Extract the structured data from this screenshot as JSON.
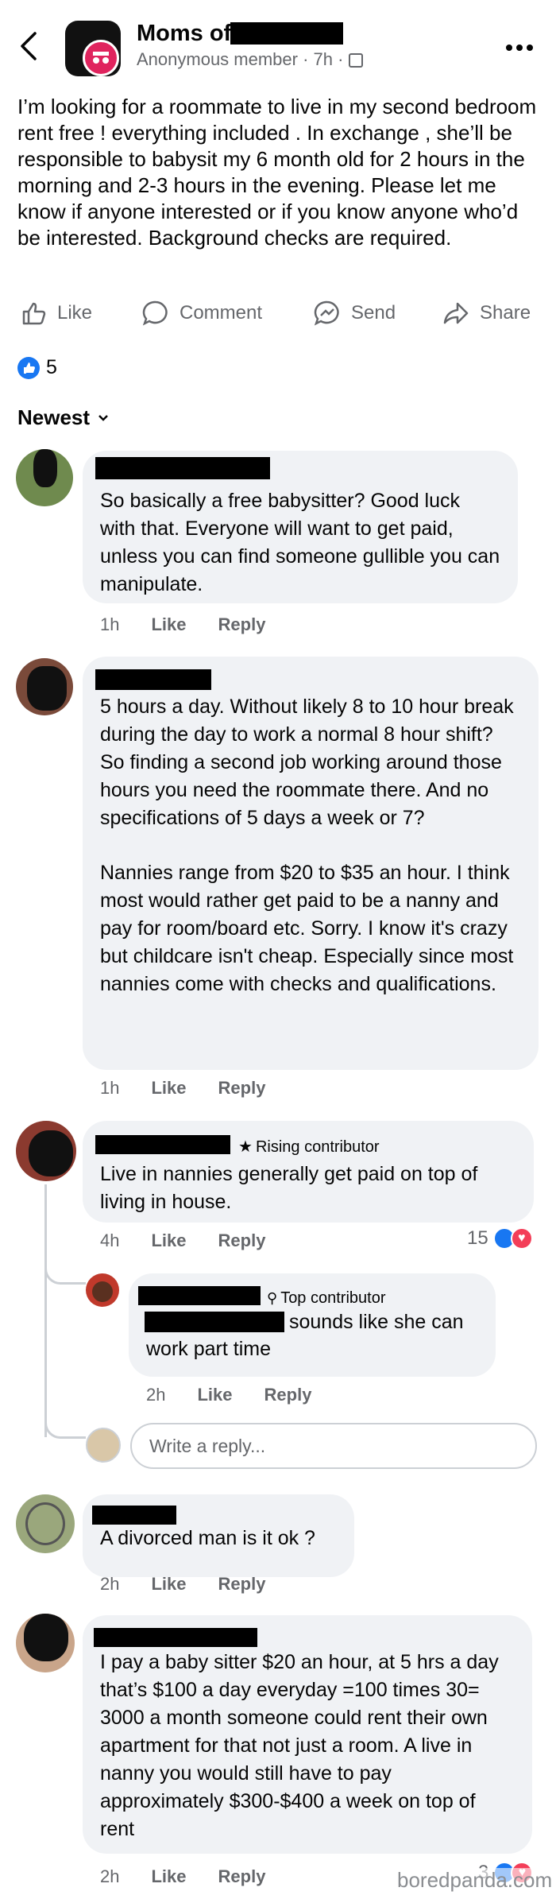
{
  "header": {
    "group_title": "Moms of",
    "author": "Anonymous member",
    "time": "7h",
    "more_label": "•••"
  },
  "post": {
    "text": "I’m looking for a roommate to live in my second bedroom rent free ! everything included . In exchange , she’ll be responsible to babysit my 6 month old for 2 hours in the morning and 2-3 hours in the evening. Please let me know if anyone interested or if you know anyone who’d be interested. Background checks are required.",
    "actions": [
      "Like",
      "Comment",
      "Send",
      "Share"
    ],
    "reaction_count": "5",
    "sort_label": "Newest"
  },
  "comments": [
    {
      "text": "So basically a free babysitter? Good luck with that. Everyone will want to get paid, unless you can find someone gullible you can manipulate.",
      "time": "1h",
      "like": "Like",
      "reply": "Reply"
    },
    {
      "text": "5 hours a day. Without likely 8 to 10 hour break during the day to work a normal 8 hour shift? So finding a second job working around those hours you need the roommate there. And no specifications of 5 days a week or 7?",
      "text2": "Nannies range from $20 to $35 an hour. I think most would rather get paid to be a nanny and pay for room/board etc. Sorry. I know it's crazy but childcare isn't cheap. Especially since most nannies come with checks and qualifications.",
      "time": "1h",
      "like": "Like",
      "reply": "Reply"
    },
    {
      "badge": "Rising contributor",
      "text": "Live in nannies generally get paid on top of living in house.",
      "time": "4h",
      "like": "Like",
      "reply": "Reply",
      "reactions": "15"
    },
    {
      "badge": "Top contributor",
      "text_tail": "sounds like she can",
      "text_line2": "work part time",
      "time": "2h",
      "like": "Like",
      "reply": "Reply"
    },
    {
      "text": "A divorced man is it ok ?",
      "time": "2h",
      "like": "Like",
      "reply": "Reply"
    },
    {
      "text": "I pay a baby sitter $20 an hour, at 5 hrs a day that’s $100 a day everyday =100 times 30= 3000 a month someone could rent their own apartment for that not just a room. A live in nanny you would still have to pay approximately $300-$400 a week on top of rent",
      "time": "2h",
      "like": "Like",
      "reply": "Reply",
      "reactions": "3"
    }
  ],
  "reply_input": {
    "placeholder": "Write a reply..."
  },
  "watermark": "boredpanda.com",
  "colors": {
    "like_blue": "#1877f2",
    "love_red": "#f33e58",
    "muted": "#65676b"
  }
}
